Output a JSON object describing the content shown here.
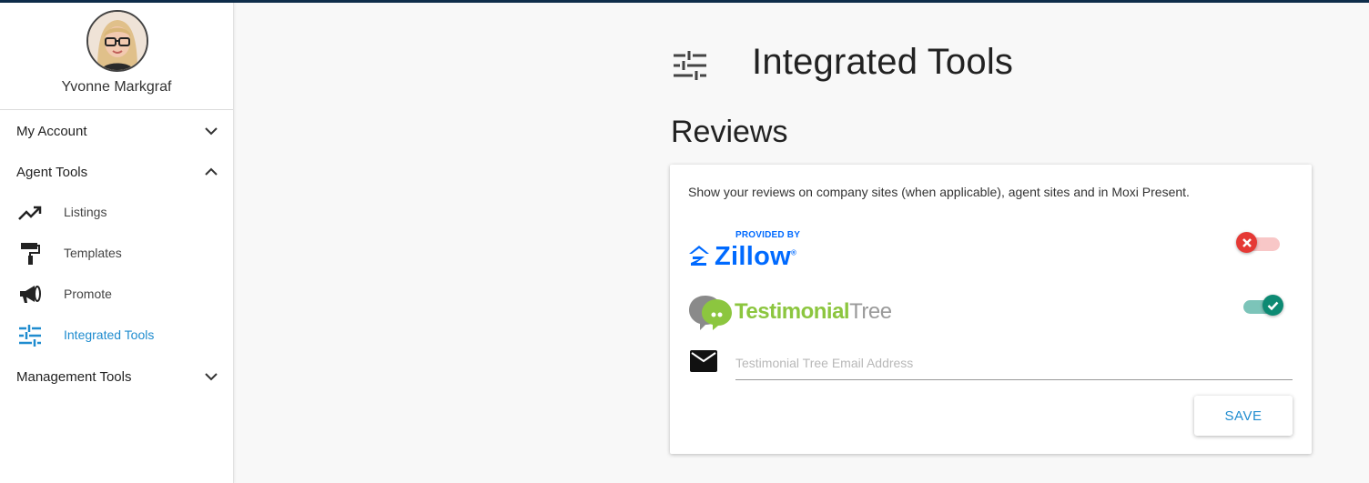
{
  "user": {
    "name": "Yvonne Markgraf"
  },
  "sidebar": {
    "sections": [
      {
        "label": "My Account",
        "expanded": false
      },
      {
        "label": "Agent Tools",
        "expanded": true
      },
      {
        "label": "Management Tools",
        "expanded": false
      }
    ],
    "agent_tools": [
      {
        "label": "Listings",
        "icon": "trending-up-icon"
      },
      {
        "label": "Templates",
        "icon": "paint-roller-icon"
      },
      {
        "label": "Promote",
        "icon": "megaphone-icon"
      },
      {
        "label": "Integrated Tools",
        "icon": "tune-sliders-icon",
        "active": true
      }
    ]
  },
  "page": {
    "title": "Integrated Tools",
    "icon": "tune-sliders-icon"
  },
  "reviews": {
    "heading": "Reviews",
    "description": "Show your reviews on company sites (when applicable), agent sites and in Moxi Present.",
    "zillow": {
      "provided_by": "PROVIDED BY",
      "name": "Zillow",
      "mark": "®",
      "enabled": false
    },
    "testimonial_tree": {
      "name_part1": "Testimonial",
      "name_part2": "Tree",
      "enabled": true
    },
    "email": {
      "placeholder": "Testimonial Tree Email Address",
      "value": ""
    },
    "save_label": "SAVE"
  },
  "colors": {
    "accent": "#1f8ccf",
    "topbar": "#0e2d4a",
    "zillow_blue": "#006aff",
    "testimonial_green": "#8cc63f",
    "toggle_off": "#e53935",
    "toggle_on": "#0d8a73"
  }
}
